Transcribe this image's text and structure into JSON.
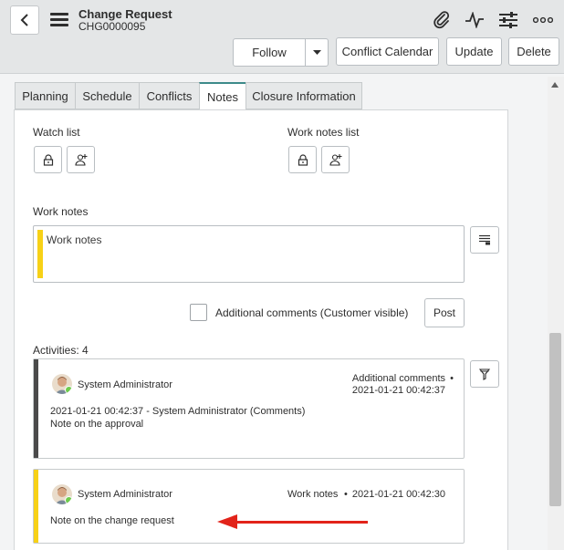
{
  "header": {
    "title": "Change Request",
    "record_number": "CHG0000095",
    "icons": [
      "back-icon",
      "menu-icon",
      "paperclip-icon",
      "activity-icon",
      "settings-sliders-icon",
      "more-icon"
    ]
  },
  "actions": {
    "follow": "Follow",
    "conflict_calendar": "Conflict Calendar",
    "update": "Update",
    "delete": "Delete"
  },
  "tabs": [
    {
      "label": "Planning"
    },
    {
      "label": "Schedule"
    },
    {
      "label": "Conflicts"
    },
    {
      "label": "Notes"
    },
    {
      "label": "Closure Information"
    }
  ],
  "notes": {
    "watch_list_label": "Watch list",
    "work_notes_list_label": "Work notes list",
    "work_notes_label": "Work notes",
    "work_notes_placeholder": "Work notes",
    "additional_comments_label": "Additional comments (Customer visible)",
    "post": "Post"
  },
  "activities": {
    "header": "Activities: 4",
    "items": [
      {
        "author": "System Administrator",
        "type": "Additional comments",
        "timestamp": "2021-01-21 00:42:37",
        "detail_line": "2021-01-21 00:42:37 - System Administrator (Comments)",
        "text": "Note on the approval",
        "stripe_color": "#4a4a4a"
      },
      {
        "author": "System Administrator",
        "type": "Work notes",
        "timestamp": "2021-01-21 00:42:30",
        "text": "Note on the change request",
        "stripe_color": "#f7d117"
      }
    ]
  },
  "colors": {
    "active_tab_accent": "#3d8a8a",
    "work_notes_accent": "#f7d117",
    "annotation_arrow": "#e2231a"
  }
}
